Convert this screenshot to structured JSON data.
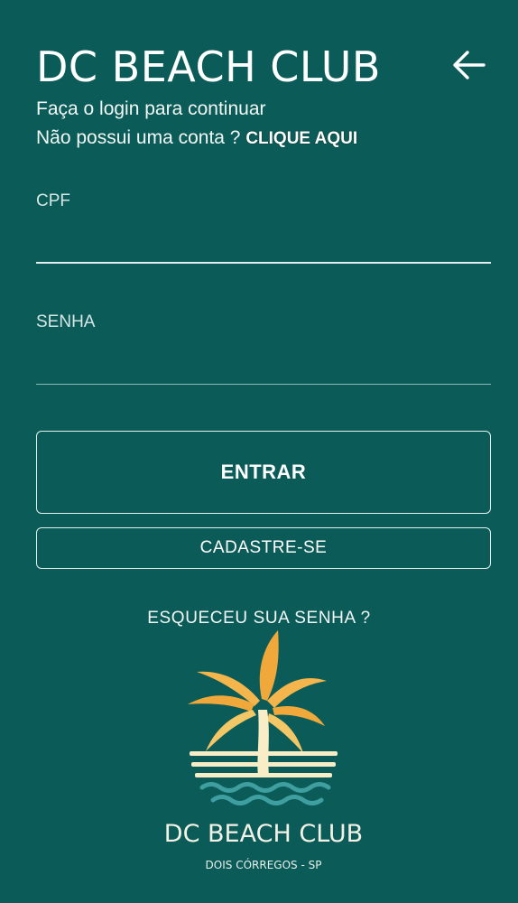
{
  "header": {
    "title": "DC BEACH CLUB",
    "subtitle": "Faça o login para continuar",
    "signup_prompt": "Não possui uma conta ? ",
    "signup_link": "CLIQUE AQUI",
    "back_icon": "arrow-left-icon"
  },
  "form": {
    "cpf_label": "CPF",
    "cpf_value": "",
    "password_label": "SENHA",
    "password_value": ""
  },
  "actions": {
    "enter_label": "ENTRAR",
    "register_label": "CADASTRE-SE",
    "forgot_label": "ESQUECEU SUA SENHA ?"
  },
  "logo": {
    "name": "DC BEACH CLUB",
    "location": "DOIS CÓRREGOS - SP",
    "icon": "palm-tree-icon"
  },
  "colors": {
    "background": "#0b5c58",
    "text": "#ffffff",
    "logo_orange": "#f0a83a",
    "logo_yellow": "#f3c766",
    "logo_cream": "#f8edc6",
    "logo_water": "#3f9ea0"
  }
}
